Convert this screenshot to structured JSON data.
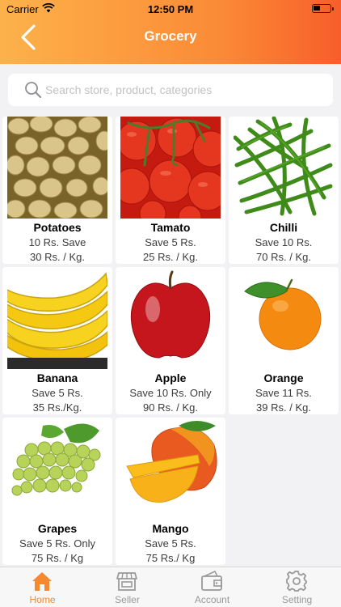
{
  "status_bar": {
    "carrier": "Carrier",
    "time": "12:50 PM"
  },
  "header": {
    "title": "Grocery",
    "back_icon": "chevron-left-icon"
  },
  "search": {
    "placeholder": "Search store, product, categories"
  },
  "products": [
    {
      "name": "Potatoes",
      "line1": "10 Rs. Save",
      "line2": "30 Rs. / Kg."
    },
    {
      "name": "Tamato",
      "line1": "Save 5 Rs.",
      "line2": "25 Rs. / Kg."
    },
    {
      "name": "Chilli",
      "line1": "Save 10 Rs.",
      "line2": "70 Rs. / Kg."
    },
    {
      "name": "Banana",
      "line1": "Save 5 Rs.",
      "line2": "35 Rs./Kg."
    },
    {
      "name": "Apple",
      "line1": "Save 10 Rs. Only",
      "line2": "90 Rs. / Kg."
    },
    {
      "name": "Orange",
      "line1": "Save 11 Rs.",
      "line2": "39 Rs. / Kg."
    },
    {
      "name": "Grapes",
      "line1": "Save 5 Rs. Only",
      "line2": "75 Rs. / Kg"
    },
    {
      "name": "Mango",
      "line1": "Save 5 Rs.",
      "line2": "75 Rs./ Kg"
    }
  ],
  "tabs": [
    {
      "label": "Home",
      "icon": "home-icon",
      "active": true
    },
    {
      "label": "Seller",
      "icon": "store-icon",
      "active": false
    },
    {
      "label": "Account",
      "icon": "wallet-icon",
      "active": false
    },
    {
      "label": "Setting",
      "icon": "gear-icon",
      "active": false
    }
  ],
  "colors": {
    "accent": "#f6882f",
    "header_start": "#fcb24a",
    "header_end": "#f75e2a"
  }
}
